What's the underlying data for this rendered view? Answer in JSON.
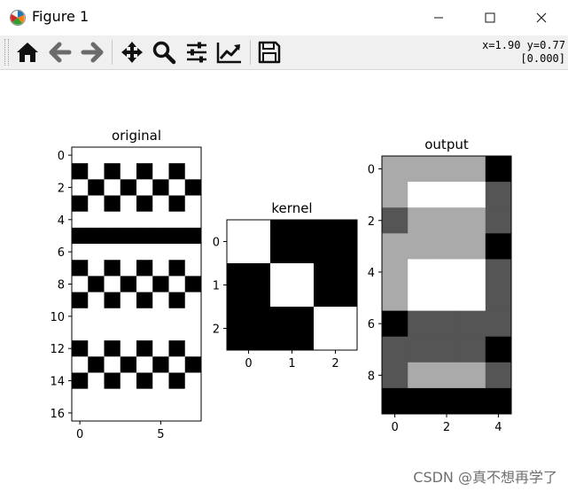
{
  "window": {
    "title": "Figure 1",
    "app_icon": "matplotlib-icon",
    "controls": {
      "minimize": "minimize-icon",
      "maximize": "maximize-icon",
      "close": "close-icon"
    }
  },
  "toolbar": {
    "tools": [
      {
        "name": "home",
        "icon": "home-icon"
      },
      {
        "name": "back",
        "icon": "back-arrow-icon"
      },
      {
        "name": "forward",
        "icon": "forward-arrow-icon"
      },
      {
        "name": "pan",
        "icon": "pan-move-icon"
      },
      {
        "name": "zoom",
        "icon": "zoom-magnifier-icon"
      },
      {
        "name": "configure-subplots",
        "icon": "subplots-sliders-icon"
      },
      {
        "name": "edit-axis",
        "icon": "chart-line-icon"
      },
      {
        "name": "save",
        "icon": "floppy-save-icon"
      }
    ],
    "coords_line1": "x=1.90 y=0.77",
    "coords_line2": "[0.000]"
  },
  "watermark": "CSDN @真不想再学了",
  "chart_data": [
    {
      "type": "heatmap",
      "title": "original",
      "colormap": "gray",
      "rows": 17,
      "cols": 8,
      "xticks": [
        0,
        5
      ],
      "yticks": [
        0,
        2,
        4,
        6,
        8,
        10,
        12,
        14,
        16
      ],
      "values": [
        [
          1,
          1,
          1,
          1,
          1,
          1,
          1,
          1
        ],
        [
          0,
          1,
          0,
          1,
          0,
          1,
          0,
          1
        ],
        [
          1,
          0,
          1,
          0,
          1,
          0,
          1,
          0
        ],
        [
          0,
          1,
          0,
          1,
          0,
          1,
          0,
          1
        ],
        [
          1,
          1,
          1,
          1,
          1,
          1,
          1,
          1
        ],
        [
          0,
          0,
          0,
          0,
          0,
          0,
          0,
          0
        ],
        [
          1,
          1,
          1,
          1,
          1,
          1,
          1,
          1
        ],
        [
          0,
          1,
          0,
          1,
          0,
          1,
          0,
          1
        ],
        [
          1,
          0,
          1,
          0,
          1,
          0,
          1,
          0
        ],
        [
          0,
          1,
          0,
          1,
          0,
          1,
          0,
          1
        ],
        [
          1,
          1,
          1,
          1,
          1,
          1,
          1,
          1
        ],
        [
          1,
          1,
          1,
          1,
          1,
          1,
          1,
          1
        ],
        [
          0,
          1,
          0,
          1,
          0,
          1,
          0,
          1
        ],
        [
          1,
          0,
          1,
          0,
          1,
          0,
          1,
          0
        ],
        [
          0,
          1,
          0,
          1,
          0,
          1,
          0,
          1
        ],
        [
          1,
          1,
          1,
          1,
          1,
          1,
          1,
          1
        ],
        [
          1,
          1,
          1,
          1,
          1,
          1,
          1,
          1
        ]
      ]
    },
    {
      "type": "heatmap",
      "title": "kernel",
      "colormap": "gray",
      "rows": 3,
      "cols": 3,
      "xticks": [
        0,
        1,
        2
      ],
      "yticks": [
        0,
        1,
        2
      ],
      "values": [
        [
          1,
          0,
          0
        ],
        [
          0,
          1,
          0
        ],
        [
          0,
          0,
          1
        ]
      ]
    },
    {
      "type": "heatmap",
      "title": "output",
      "colormap": "gray",
      "rows": 10,
      "cols": 5,
      "xticks": [
        0,
        2,
        4
      ],
      "yticks": [
        0,
        2,
        4,
        6,
        8
      ],
      "values": [
        [
          0.667,
          0.667,
          0.667,
          0.667,
          0
        ],
        [
          0.667,
          1,
          1,
          1,
          0.333
        ],
        [
          0.333,
          0.667,
          0.667,
          0.667,
          0.333
        ],
        [
          0.667,
          0.667,
          0.667,
          0.667,
          0
        ],
        [
          0.667,
          1,
          1,
          1,
          0.333
        ],
        [
          0.667,
          1,
          1,
          1,
          0.333
        ],
        [
          0,
          0.333,
          0.333,
          0.333,
          0.333
        ],
        [
          0.333,
          0.333,
          0.333,
          0.333,
          0
        ],
        [
          0.333,
          0.667,
          0.667,
          0.667,
          0.333
        ],
        [
          0,
          0,
          0,
          0,
          0
        ]
      ]
    }
  ]
}
